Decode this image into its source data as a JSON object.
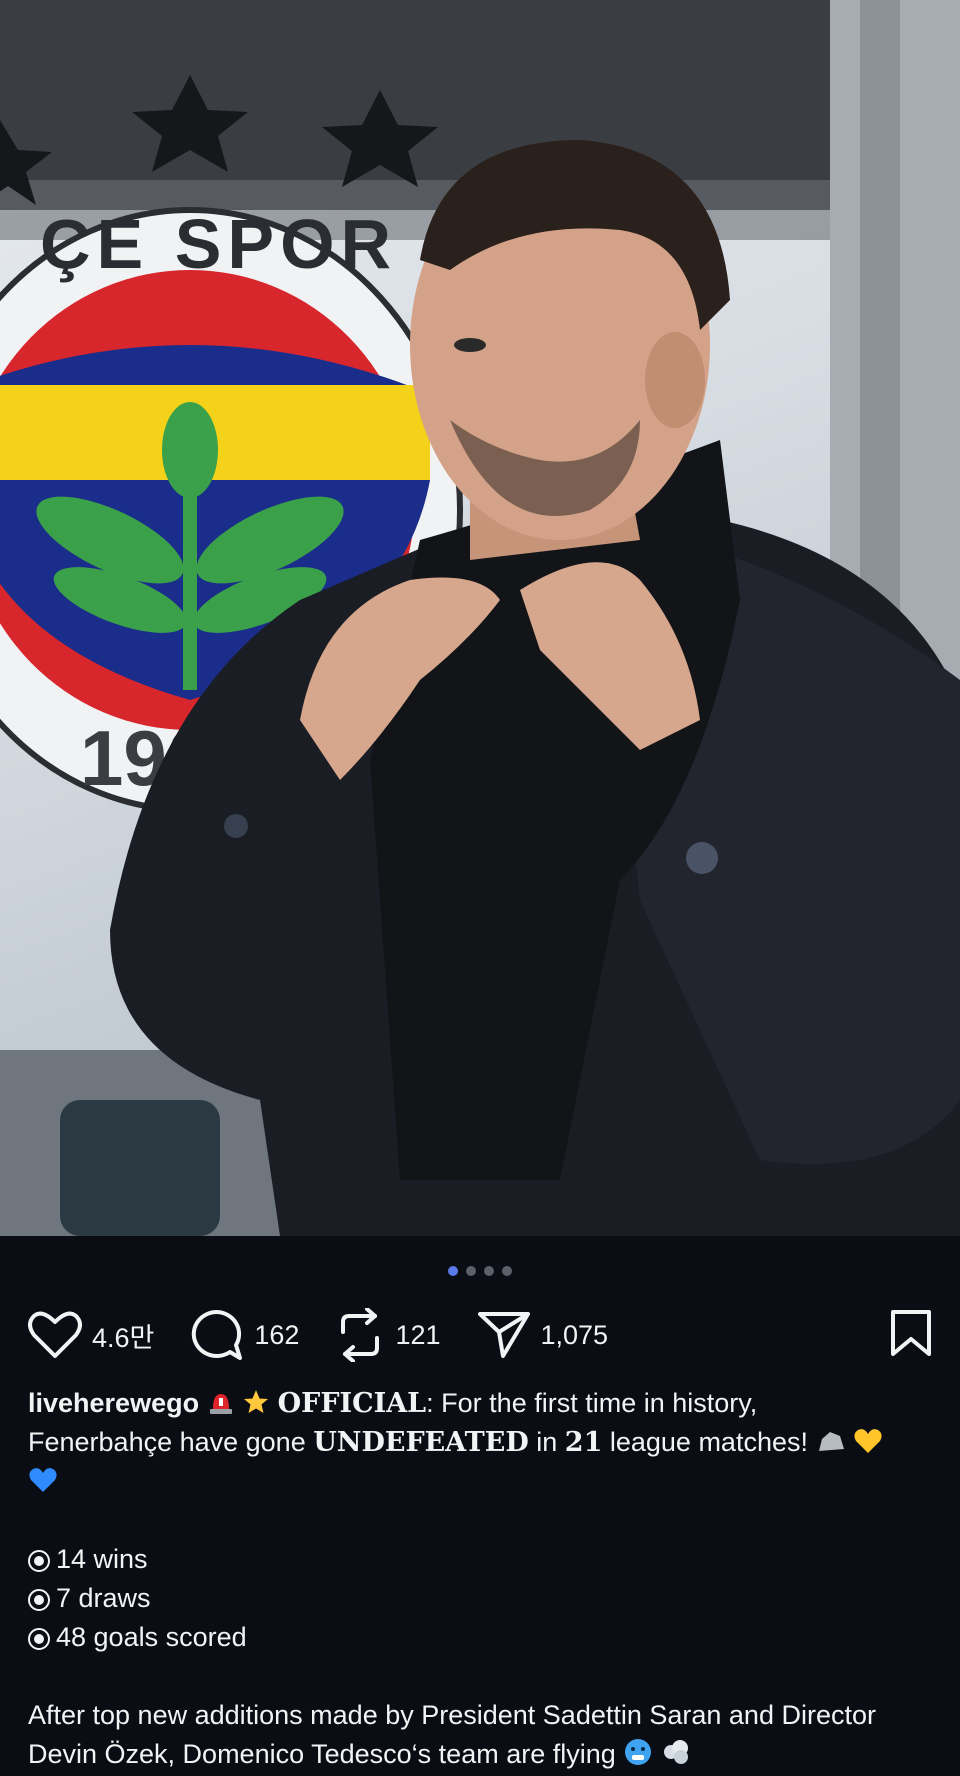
{
  "post": {
    "image_alt": "Man in dark coat and scarf adjusting collar in front of club crest",
    "crest_text_top": "ÇE SPOR",
    "crest_text_bottom": "190",
    "carousel": {
      "total": 4,
      "active": 1
    }
  },
  "actions": {
    "likes": "4.6만",
    "comments": "162",
    "reposts": "121",
    "shares": "1,075"
  },
  "caption": {
    "username": "liveherewego",
    "official": "OFFICIAL",
    "line1_after": ": For the first time in history,",
    "line2_pre": "Fenerbahçe have gone ",
    "undefeated": "UNDEFEATED",
    "line2_mid": " in ",
    "number": "21",
    "line2_post": " league matches!",
    "stats": [
      "14 wins",
      "7 draws",
      "48 goals scored"
    ],
    "paragraph": "After top new additions made by President Sadettin Saran and Director Devin Özek, Domenico Tedesco‘s team are flying"
  },
  "colors": {
    "background": "#0b0d14",
    "text": "#f2f3f5",
    "carousel_active": "#5a7ae8",
    "crest_red": "#d8262d",
    "crest_yellow": "#f5d21a",
    "crest_blue": "#1b2d8a",
    "crest_green": "#3aa14a"
  }
}
